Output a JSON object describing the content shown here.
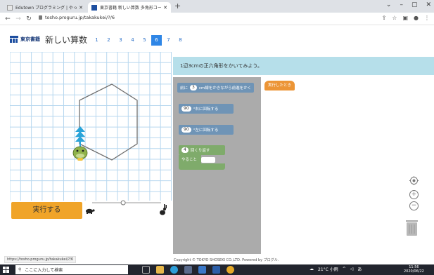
{
  "browser": {
    "tabs": [
      {
        "label": "Edutown プログラミング | やってみよう",
        "active": false
      },
      {
        "label": "東京書籍 新しい算数 多角形コース",
        "active": true
      }
    ],
    "new_tab": "+",
    "url": "tosho.proguru.jp/takakukei/?/6",
    "window_controls": [
      "⌄",
      "–",
      "▢",
      "✕"
    ]
  },
  "app": {
    "logo_text": "東京書籍",
    "course_title": "新しい算数",
    "lessons": [
      "1",
      "2",
      "3",
      "4",
      "5",
      "6",
      "7",
      "8"
    ],
    "active_lesson": "6"
  },
  "stage": {
    "run_label": "実行する",
    "speed": {
      "slow_icon": "turtle-icon",
      "fast_icon": "rabbit-icon",
      "level": 0.45
    }
  },
  "task": {
    "text": "1辺3cmの正六角形をかいてみよう。"
  },
  "palette": {
    "move_block": {
      "prefix": "前に",
      "value": "3",
      "suffix": "cm線をかきながら前進をかく"
    },
    "turn_right": {
      "value": "90",
      "suffix": "°右に回転する"
    },
    "turn_left": {
      "value": "90",
      "suffix": "°左に回転する"
    },
    "repeat": {
      "value": "4",
      "suffix": "回くり返す",
      "body": "やること"
    }
  },
  "workspace": {
    "hat_label": "実行したとき"
  },
  "footer": {
    "status_url": "https://tosho.proguru.jp/takakukei/?/6",
    "copyright": "Copyright © TOKYO SHOSEKI CO.,LTD. Powered by プログル."
  },
  "taskbar": {
    "search_placeholder": "ここに入力して検索",
    "weather": "21°C 小雨",
    "ime": "あ",
    "time": "11:56",
    "date": "2020/06/22"
  },
  "colors": {
    "active_lesson": "#2f86e6",
    "run_button": "#f0a429",
    "task_bar": "#b6dfea",
    "palette_bg": "#ababab",
    "motion_block": "#6f94b6",
    "control_block": "#7fab6b",
    "event_block": "#ec9536"
  }
}
